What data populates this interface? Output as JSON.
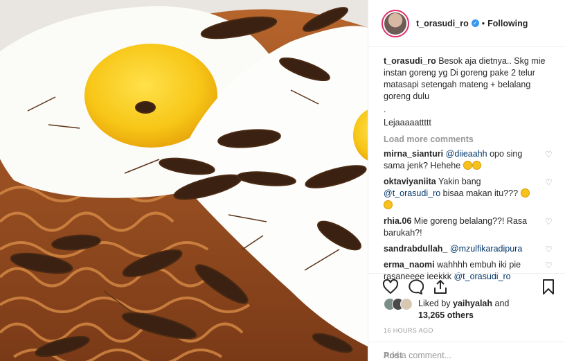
{
  "post": {
    "image_alt": "Fried instant noodles with two fried eggs topped with fried grasshoppers",
    "colors": {
      "mention": "#003569",
      "muted": "#999999",
      "verified": "#3897f0"
    }
  },
  "header": {
    "username": "t_orasudi_ro",
    "verified_icon": "verified-badge-icon",
    "separator": "•",
    "follow_status": "Following"
  },
  "caption": {
    "username": "t_orasudi_ro",
    "text": "Besok aja dietnya.. Skg mie instan goreng yg Di goreng pake 2 telur matasapi setengah mateng + belalang goreng dulu",
    "line2": ".",
    "line3": "Lejaaaaattttt"
  },
  "load_more": "Load more comments",
  "comments": [
    {
      "username": "mirna_sianturi",
      "mention": "@diieaahh",
      "text": " opo sing sama jenk? Hehehe"
    },
    {
      "username": "oktaviyaniita",
      "text": "Yakin bang ",
      "mention": "@t_orasudi_ro",
      "text2": " bisaa makan itu???"
    },
    {
      "username": "rhia.06",
      "text": "Mie goreng belalang??! Rasa barukah?!"
    },
    {
      "username": "sandrabdullah_",
      "mention": "@mzulfikaradipura"
    },
    {
      "username": "erma_naomi",
      "text": "wahhhh embuh iki pie rasaneeee leekkk ",
      "mention": "@t_orasudi_ro"
    }
  ],
  "likes": {
    "prefix": "Liked by ",
    "user": "yaihyalah",
    "middle": " and",
    "count": "13,265 others"
  },
  "timestamp": "16 HOURS AGO",
  "add_comment": {
    "placeholder": "Add a comment...",
    "post_label": "Post"
  }
}
